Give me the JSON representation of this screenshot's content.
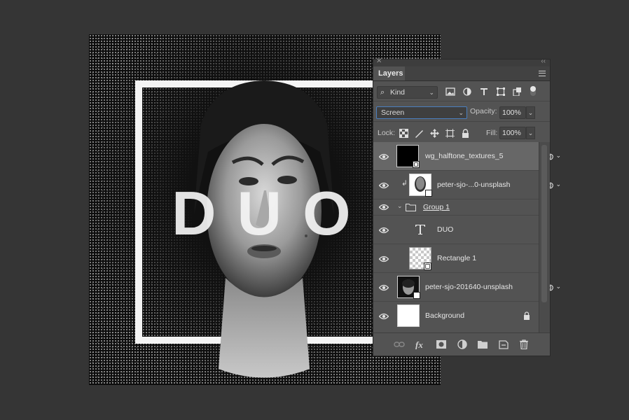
{
  "artwork": {
    "title_letters": "DUO"
  },
  "panel": {
    "close_glyph": "✕",
    "collapse_glyph": "‹‹",
    "tab_label": "Layers",
    "filter": {
      "kind_label": "Kind"
    },
    "blend": {
      "mode": "Screen",
      "opacity_label": "Opacity:",
      "opacity_value": "100%"
    },
    "lock": {
      "label": "Lock:",
      "fill_label": "Fill:",
      "fill_value": "100%"
    },
    "layers": [
      {
        "name": "wg_halftone_textures_5",
        "selected": true
      },
      {
        "name": "peter-sjo-...0-unsplash",
        "clipped": true
      },
      {
        "name": "Group 1",
        "type": "group",
        "expanded": true
      },
      {
        "name": "DUO",
        "type": "text"
      },
      {
        "name": "Rectangle 1",
        "type": "shape"
      },
      {
        "name": "peter-sjo-201640-unsplash"
      },
      {
        "name": "Background",
        "locked": true
      }
    ]
  },
  "icons": [
    "search-icon",
    "image-filter-icon",
    "adjustment-filter-icon",
    "type-filter-icon",
    "shape-filter-icon",
    "smart-object-filter-icon",
    "eye-icon",
    "folder-icon",
    "lock-icon",
    "link-icon",
    "fx-icon",
    "mask-icon",
    "adjustment-icon",
    "new-group-icon",
    "new-layer-icon",
    "trash-icon"
  ],
  "colors": {
    "app_bg": "#353535",
    "panel_bg": "#535353",
    "selected_row": "#676767",
    "blend_focus": "#4a7fbf"
  }
}
